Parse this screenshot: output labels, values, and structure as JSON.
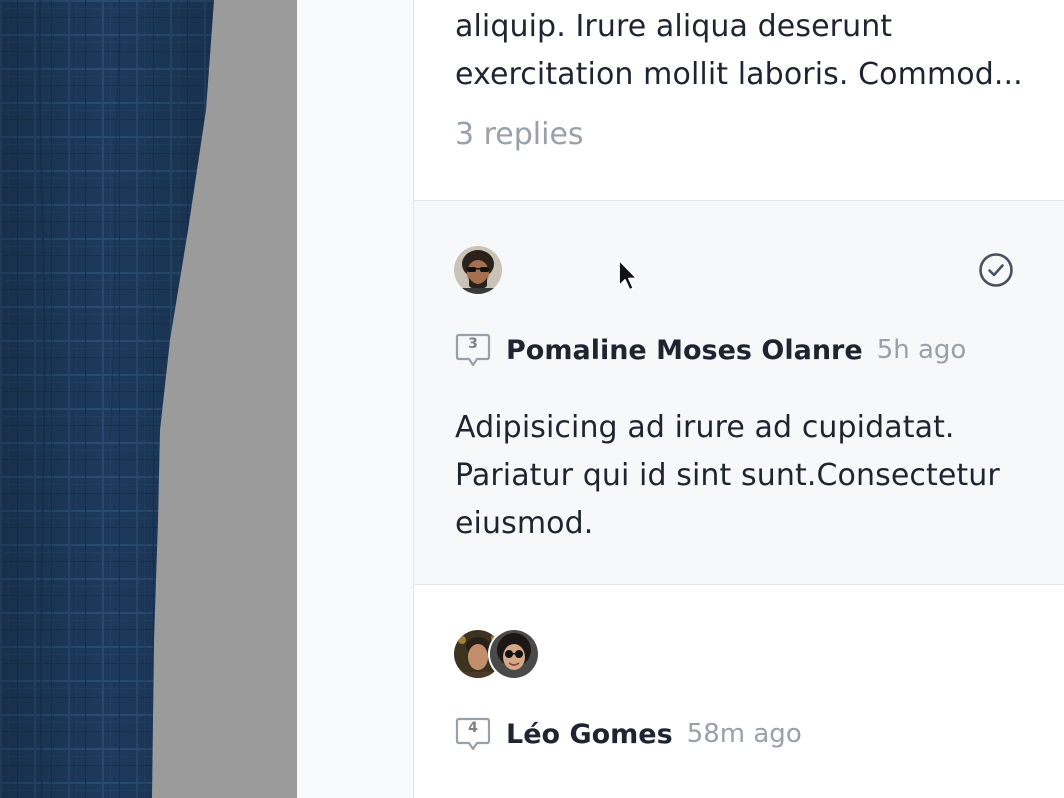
{
  "threads": [
    {
      "body_lines": [
        "aliquip. Irure aliqua deserunt",
        "exercitation mollit laboris. Commod..."
      ],
      "replies_label": "3 replies"
    },
    {
      "avatar_icon": "person-sunglasses-avatar",
      "resolve_icon": "check-circle-icon",
      "reply_count": "3",
      "author": "Pomaline Moses Olanre",
      "time": "5h ago",
      "body_lines": [
        "Adipisicing ad irure ad cupidatat.",
        "Pariatur qui id sint sunt.Consectetur",
        "eiusmod."
      ]
    },
    {
      "avatar_icons": [
        "person-avatar",
        "person-sunglasses-avatar"
      ],
      "reply_count": "4",
      "author": "Léo Gomes",
      "time": "58m ago"
    }
  ],
  "colors": {
    "text_primary": "#1f2430",
    "text_muted": "#9aa0a9",
    "selected_thread_bg": "#f7f8fa",
    "canvas_bg": "#9b9b9b",
    "fabric_navy": "#1d3a5c"
  }
}
